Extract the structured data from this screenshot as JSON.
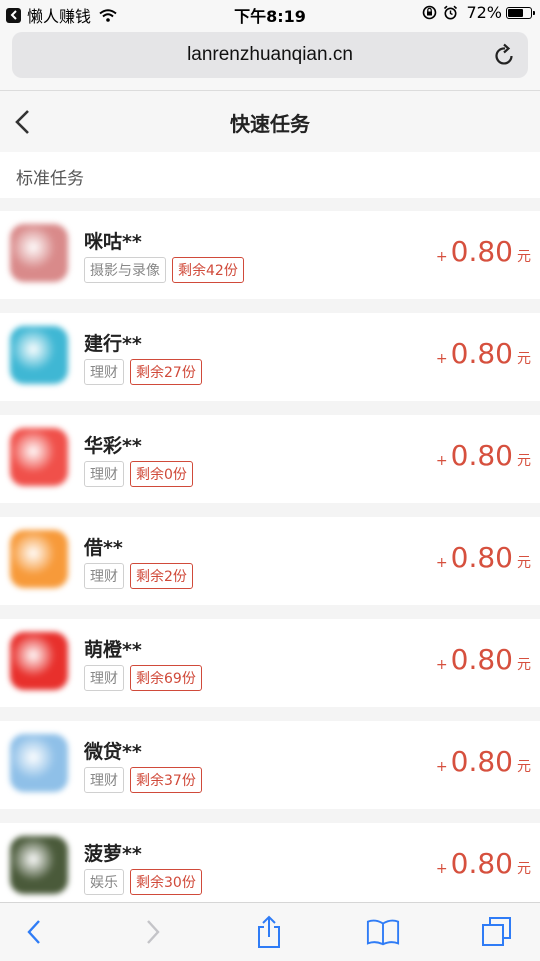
{
  "status_bar": {
    "app_name": "懒人赚钱",
    "time": "下午8:19",
    "battery": "72%",
    "battery_level": 0.72
  },
  "url_bar": {
    "url": "lanrenzhuanqian.cn"
  },
  "header": {
    "title": "快速任务"
  },
  "section": {
    "label": "标准任务"
  },
  "tasks": [
    {
      "name": "咪咕**",
      "category": "摄影与录像",
      "remaining": "剩余42份",
      "plus": "+",
      "amount": "0.80",
      "unit": "元",
      "icon_color": "#d98a8a"
    },
    {
      "name": "建行**",
      "category": "理财",
      "remaining": "剩余27份",
      "plus": "+",
      "amount": "0.80",
      "unit": "元",
      "icon_color": "#3fb7d4"
    },
    {
      "name": "华彩**",
      "category": "理财",
      "remaining": "剩余0份",
      "plus": "+",
      "amount": "0.80",
      "unit": "元",
      "icon_color": "#f0504a"
    },
    {
      "name": "借**",
      "category": "理财",
      "remaining": "剩余2份",
      "plus": "+",
      "amount": "0.80",
      "unit": "元",
      "icon_color": "#f79a3a"
    },
    {
      "name": "萌橙**",
      "category": "理财",
      "remaining": "剩余69份",
      "plus": "+",
      "amount": "0.80",
      "unit": "元",
      "icon_color": "#e8302c"
    },
    {
      "name": "微贷**",
      "category": "理财",
      "remaining": "剩余37份",
      "plus": "+",
      "amount": "0.80",
      "unit": "元",
      "icon_color": "#8fc0e8"
    },
    {
      "name": "菠萝**",
      "category": "娱乐",
      "remaining": "剩余30份",
      "plus": "+",
      "amount": "0.80",
      "unit": "元",
      "icon_color": "#4a5a3a"
    }
  ],
  "colors": {
    "accent": "#d6503e",
    "toolbar_icon": "#2f7cf6"
  },
  "icons": {
    "status_back": "back-to-app-icon",
    "wifi": "wifi-icon",
    "lock_rotation": "orientation-lock-icon",
    "alarm": "alarm-icon",
    "battery": "battery-icon",
    "reload": "reload-icon",
    "nav_back": "chevron-left-icon",
    "toolbar": [
      "back-arrow-icon",
      "forward-arrow-icon",
      "share-icon",
      "bookmarks-icon",
      "tabs-icon"
    ]
  }
}
